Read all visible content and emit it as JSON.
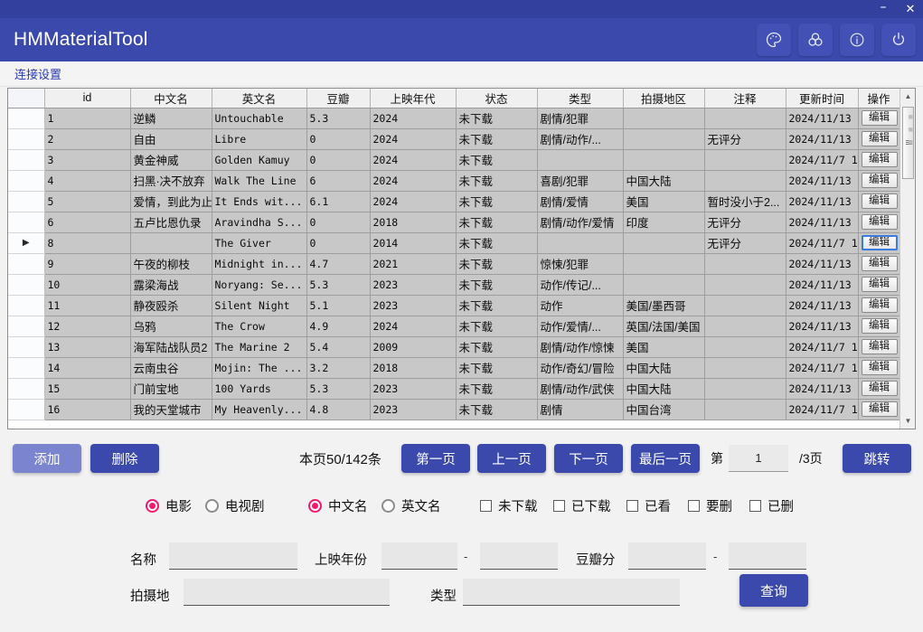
{
  "window": {
    "title": "HMMaterialTool",
    "minimize_label": "–",
    "close_label": "✕",
    "accent": "#3b49ad",
    "titlebar_dark": "#33409e",
    "icons": [
      "palette-icon",
      "color-circles-icon",
      "info-icon",
      "power-icon"
    ]
  },
  "menu": {
    "items": [
      {
        "label": "连接设置"
      }
    ]
  },
  "grid": {
    "columns": [
      "id",
      "中文名",
      "英文名",
      "豆瓣",
      "上映年代",
      "状态",
      "类型",
      "拍摄地区",
      "注释",
      "更新时间",
      "操作"
    ],
    "action_label": "编辑",
    "selected_row_index": 6,
    "rows": [
      {
        "id": "1",
        "cn": "逆鳞",
        "en": "Untouchable",
        "douban": "5.3",
        "year": "2024",
        "status": "未下载",
        "genre": "剧情/犯罪",
        "region": "",
        "note": "",
        "updated": "2024/11/13 ..."
      },
      {
        "id": "2",
        "cn": "自由",
        "en": "Libre",
        "douban": "0",
        "year": "2024",
        "status": "未下载",
        "genre": "剧情/动作/...",
        "region": "",
        "note": "无评分",
        "updated": "2024/11/13 ..."
      },
      {
        "id": "3",
        "cn": "黄金神威",
        "en": "Golden Kamuy",
        "douban": "0",
        "year": "2024",
        "status": "未下载",
        "genre": "",
        "region": "",
        "note": "",
        "updated": "2024/11/7 1..."
      },
      {
        "id": "4",
        "cn": "扫黑·决不放弃",
        "en": "Walk The Line",
        "douban": "6",
        "year": "2024",
        "status": "未下载",
        "genre": "喜剧/犯罪",
        "region": "中国大陆",
        "note": "",
        "updated": "2024/11/13 ..."
      },
      {
        "id": "5",
        "cn": "爱情，到此为止",
        "en": "It Ends wit...",
        "douban": "6.1",
        "year": "2024",
        "status": "未下载",
        "genre": "剧情/爱情",
        "region": "美国",
        "note": "暂时没小于2...",
        "updated": "2024/11/13 ..."
      },
      {
        "id": "6",
        "cn": "五卢比恩仇录",
        "en": "Aravindha S...",
        "douban": "0",
        "year": "2018",
        "status": "未下载",
        "genre": "剧情/动作/爱情",
        "region": "印度",
        "note": "无评分",
        "updated": "2024/11/13 ..."
      },
      {
        "id": "8",
        "cn": "",
        "en": "The Giver",
        "douban": "0",
        "year": "2014",
        "status": "未下载",
        "genre": "",
        "region": "",
        "note": "无评分",
        "updated": "2024/11/7 1..."
      },
      {
        "id": "9",
        "cn": "午夜的柳枝",
        "en": "Midnight in...",
        "douban": "4.7",
        "year": "2021",
        "status": "未下载",
        "genre": "惊悚/犯罪",
        "region": "",
        "note": "",
        "updated": "2024/11/13 ..."
      },
      {
        "id": "10",
        "cn": "露梁海战",
        "en": "Noryang: Se...",
        "douban": "5.3",
        "year": "2023",
        "status": "未下载",
        "genre": "动作/传记/...",
        "region": "",
        "note": "",
        "updated": "2024/11/13 ..."
      },
      {
        "id": "11",
        "cn": "静夜殴杀",
        "en": "Silent Night",
        "douban": "5.1",
        "year": "2023",
        "status": "未下载",
        "genre": "动作",
        "region": "美国/墨西哥",
        "note": "",
        "updated": "2024/11/13 ..."
      },
      {
        "id": "12",
        "cn": "乌鸦",
        "en": "The Crow",
        "douban": "4.9",
        "year": "2024",
        "status": "未下载",
        "genre": "动作/爱情/...",
        "region": "英国/法国/美国",
        "note": "",
        "updated": "2024/11/13 ..."
      },
      {
        "id": "13",
        "cn": "海军陆战队员2",
        "en": "The Marine 2",
        "douban": "5.4",
        "year": "2009",
        "status": "未下载",
        "genre": "剧情/动作/惊悚",
        "region": "美国",
        "note": "",
        "updated": "2024/11/7 1..."
      },
      {
        "id": "14",
        "cn": "云南虫谷",
        "en": "Mojin: The ...",
        "douban": "3.2",
        "year": "2018",
        "status": "未下载",
        "genre": "动作/奇幻/冒险",
        "region": "中国大陆",
        "note": "",
        "updated": "2024/11/7 1..."
      },
      {
        "id": "15",
        "cn": "门前宝地",
        "en": "100 Yards",
        "douban": "5.3",
        "year": "2023",
        "status": "未下载",
        "genre": "剧情/动作/武侠",
        "region": "中国大陆",
        "note": "",
        "updated": "2024/11/13 ..."
      },
      {
        "id": "16",
        "cn": "我的天堂城市",
        "en": "My Heavenly...",
        "douban": "4.8",
        "year": "2023",
        "status": "未下载",
        "genre": "剧情",
        "region": "中国台湾",
        "note": "",
        "updated": "2024/11/7 1..."
      }
    ]
  },
  "pager": {
    "add_label": "添加",
    "delete_label": "删除",
    "count_text": "本页50/142条",
    "first_label": "第一页",
    "prev_label": "上一页",
    "next_label": "下一页",
    "last_label": "最后一页",
    "page_prefix": "第",
    "page_value": "1",
    "page_suffix": "/3页",
    "jump_label": "跳转"
  },
  "options": {
    "radios_type": [
      {
        "label": "电影",
        "checked": true
      },
      {
        "label": "电视剧",
        "checked": false
      }
    ],
    "radios_name": [
      {
        "label": "中文名",
        "checked": true
      },
      {
        "label": "英文名",
        "checked": false
      }
    ],
    "checkboxes": [
      {
        "label": "未下载",
        "checked": false
      },
      {
        "label": "已下载",
        "checked": false
      },
      {
        "label": "已看",
        "checked": false
      },
      {
        "label": "要删",
        "checked": false
      },
      {
        "label": "已删",
        "checked": false
      }
    ],
    "radio_accent": "#f7176d"
  },
  "form": {
    "name_label": "名称",
    "name_value": "",
    "year_label": "上映年份",
    "year_from": "",
    "year_to": "",
    "douban_label": "豆瓣分",
    "douban_from": "",
    "douban_to": "",
    "region_label": "拍摄地",
    "region_value": "",
    "genre_label": "类型",
    "genre_value": "",
    "dash": "-",
    "search_label": "查询"
  }
}
